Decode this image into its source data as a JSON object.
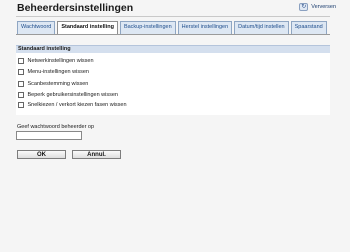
{
  "header": {
    "title": "Beheerdersinstellingen",
    "refresh_label": "Verversen",
    "refresh_icon": "refresh-icon"
  },
  "tabs": [
    {
      "label": "Wachtwoord",
      "active": false
    },
    {
      "label": "Standaard instelling",
      "active": true
    },
    {
      "label": "Backup-instellingen",
      "active": false
    },
    {
      "label": "Herstel instellingen",
      "active": false
    },
    {
      "label": "Datum/tijd instellen",
      "active": false
    },
    {
      "label": "Spaarstand",
      "active": false
    }
  ],
  "section": {
    "title": "Standaard instelling",
    "options": [
      {
        "label": "Netwerkinstellingen wissen",
        "checked": false
      },
      {
        "label": "Menu-instellingen wissen",
        "checked": false
      },
      {
        "label": "Scanbestemming wissen",
        "checked": false
      },
      {
        "label": "Beperk gebruikersinstellingen wissen",
        "checked": false
      },
      {
        "label": "Snelkiezen / verkort kiezen fasen wissen",
        "checked": false
      }
    ]
  },
  "password": {
    "label": "Geef wachtwoord beheerder op",
    "value": ""
  },
  "buttons": {
    "ok": "OK",
    "cancel": "Annul."
  },
  "colors": {
    "tab_bg": "#dde7f3",
    "tab_text": "#1e4d8c",
    "section_header": "#d4dfee"
  }
}
